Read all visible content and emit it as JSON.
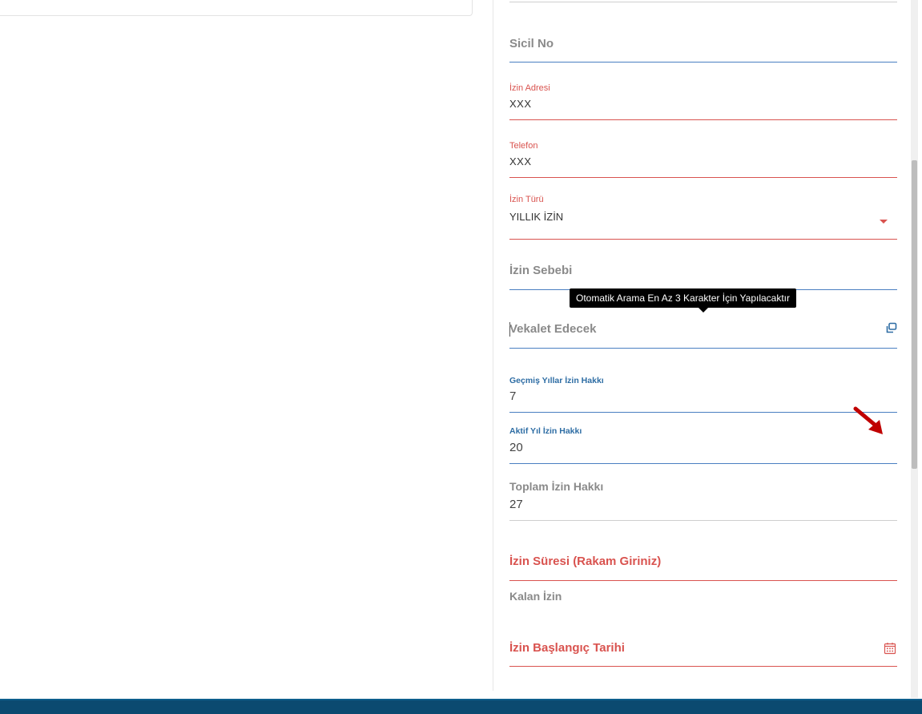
{
  "form": {
    "sicil_no": {
      "placeholder": "Sicil No"
    },
    "izin_adresi": {
      "label": "İzin Adresi",
      "value": "XXX"
    },
    "telefon": {
      "label": "Telefon",
      "value": "XXX"
    },
    "izin_turu": {
      "label": "İzin Türü",
      "value": "YILLIK İZİN"
    },
    "izin_sebebi": {
      "placeholder": "İzin Sebebi"
    },
    "vekalet_edecek": {
      "placeholder": "Vekalet Edecek"
    },
    "gecmis_yillar": {
      "label": "Geçmiş Yıllar İzin Hakkı",
      "value": "7"
    },
    "aktif_yil": {
      "label": "Aktif Yıl İzin Hakkı",
      "value": "20"
    },
    "toplam": {
      "label": "Toplam İzin Hakkı",
      "value": "27"
    },
    "izin_suresi": {
      "placeholder": "İzin Süresi (Rakam Giriniz)"
    },
    "kalan_izin": {
      "label": "Kalan İzin"
    },
    "baslangic": {
      "placeholder": "İzin Başlangıç Tarihi"
    }
  },
  "tooltip": {
    "text": "Otomatik Arama En Az 3 Karakter İçin Yapılacaktır"
  },
  "colors": {
    "accent_blue": "#4a7fc1",
    "required_red": "#d9534f",
    "annotation_arrow": "#c00000",
    "bottom_bar": "#0b4a70"
  },
  "icons": {
    "vekalet": "open-in-new-icon",
    "baslangic": "calendar-icon",
    "izin_turu": "caret-down-icon"
  }
}
